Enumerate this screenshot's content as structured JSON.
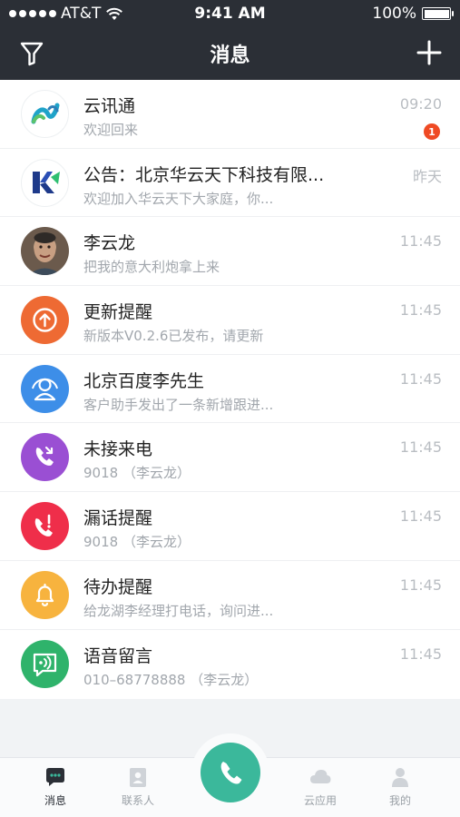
{
  "status_bar": {
    "carrier": "AT&T",
    "time": "9:41 AM",
    "battery": "100%",
    "battery_level": 1.0
  },
  "navbar": {
    "title": "消息"
  },
  "conversations": [
    {
      "name": "云讯通",
      "preview": "欢迎回来",
      "time": "09:20",
      "badge": "1",
      "avatar_icon": "yunxuntong-logo-icon",
      "avatar_color": "#ffffff"
    },
    {
      "name": "公告：北京华云天下科技有限...",
      "preview": "欢迎加入华云天下大家庭，你...",
      "time": "昨天",
      "avatar_icon": "huayun-logo-icon",
      "avatar_color": "#ffffff"
    },
    {
      "name": "李云龙",
      "preview": "把我的意大利炮拿上来",
      "time": "11:45",
      "avatar_icon": "user-photo",
      "avatar_color": "#8a7a6a"
    },
    {
      "name": "更新提醒",
      "preview": "新版本V0.2.6已发布，请更新",
      "time": "11:45",
      "avatar_icon": "upload-arrow-icon",
      "avatar_color": "#ee6a33"
    },
    {
      "name": "北京百度李先生",
      "preview": "客户助手发出了一条新增跟进...",
      "time": "11:45",
      "avatar_icon": "customer-icon",
      "avatar_color": "#3d8ee8"
    },
    {
      "name": "未接来电",
      "preview": "9018 （李云龙）",
      "time": "11:45",
      "avatar_icon": "missed-call-icon",
      "avatar_color": "#9a4fd3"
    },
    {
      "name": "漏话提醒",
      "preview": "9018 （李云龙）",
      "time": "11:45",
      "avatar_icon": "call-alert-icon",
      "avatar_color": "#ef2e4a"
    },
    {
      "name": "待办提醒",
      "preview": "给龙湖李经理打电话，询问进...",
      "time": "11:45",
      "avatar_icon": "bell-icon",
      "avatar_color": "#f7b33e"
    },
    {
      "name": "语音留言",
      "preview": "010–68778888 （李云龙）",
      "time": "11:45",
      "avatar_icon": "voicemail-icon",
      "avatar_color": "#2fb36b"
    }
  ],
  "tabbar": {
    "tabs": [
      {
        "label": "消息",
        "icon": "chat-icon",
        "active": true
      },
      {
        "label": "联系人",
        "icon": "contacts-icon",
        "active": false
      },
      {
        "label": "云应用",
        "icon": "cloud-icon",
        "active": false
      },
      {
        "label": "我的",
        "icon": "profile-icon",
        "active": false
      }
    ],
    "call_icon": "phone-icon"
  },
  "colors": {
    "header_bg": "#2b2f36",
    "accent": "#3bb89b",
    "badge": "#ef4a24"
  }
}
